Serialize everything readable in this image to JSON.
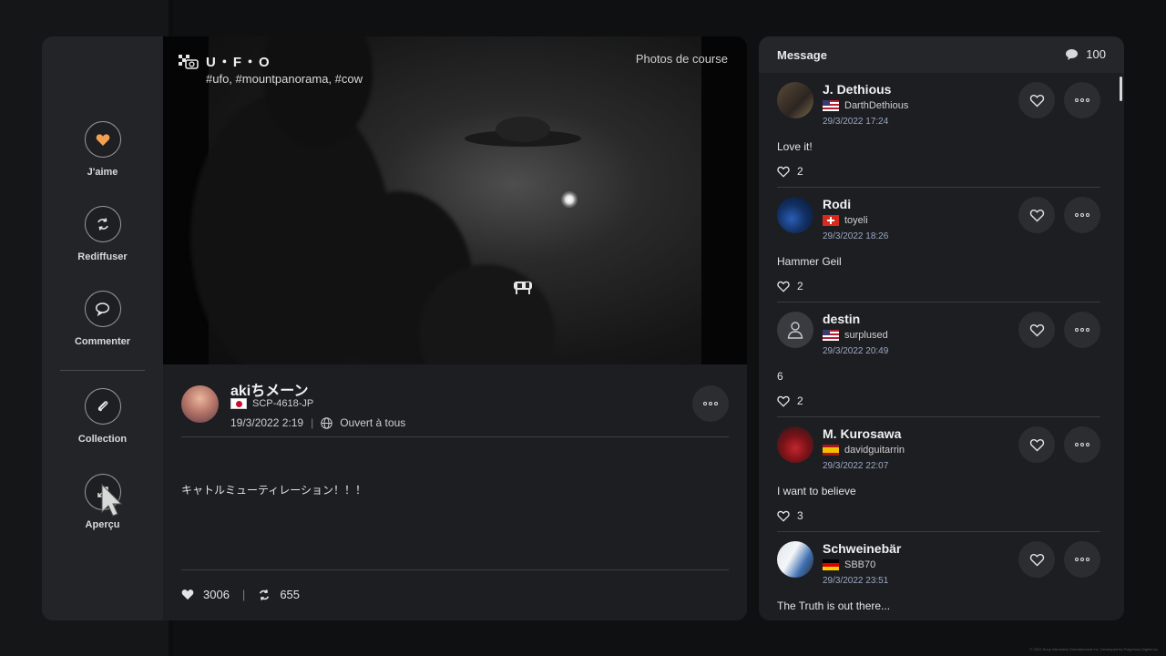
{
  "actions": {
    "like": "J'aime",
    "repost": "Rediffuser",
    "comment": "Commenter",
    "collection": "Collection",
    "preview": "Aperçu"
  },
  "photo": {
    "title": "U・F・O",
    "tags": "#ufo, #mountpanorama, #cow",
    "category": "Photos de course"
  },
  "post": {
    "author": "akiちメーン",
    "user_id": "SCP-4618-JP",
    "country_flag": "jp-flag-icon",
    "date": "19/3/2022 2:19",
    "visibility": "Ouvert à tous",
    "text": "キャトルミューティレーション！！！",
    "likes": "3006",
    "reposts": "655"
  },
  "messages": {
    "title": "Message",
    "count": "100",
    "items": [
      {
        "name": "J. Dethious",
        "user": "DarthDethious",
        "flag": "us",
        "date": "29/3/2022 17:24",
        "text": "Love it!",
        "likes": "2"
      },
      {
        "name": "Rodi",
        "user": "toyeli",
        "flag": "ch",
        "date": "29/3/2022 18:26",
        "text": "Hammer Geil",
        "likes": "2"
      },
      {
        "name": "destin",
        "user": "surplused",
        "flag": "us",
        "date": "29/3/2022 20:49",
        "text": "6",
        "likes": "2"
      },
      {
        "name": "M. Kurosawa",
        "user": "davidguitarrin",
        "flag": "es",
        "date": "29/3/2022 22:07",
        "text": "I want to believe",
        "likes": "3"
      },
      {
        "name": "Schweinebär",
        "user": "SBB70",
        "flag": "de",
        "date": "29/3/2022 23:51",
        "text": "The Truth is out there...",
        "likes": ""
      }
    ]
  },
  "footer": "© 2022 Sony Interactive Entertainment Inc. Developed by Polyphony Digital Inc.",
  "colors": {
    "accent_heart": "#f0a050",
    "panel": "#1d1e21",
    "date_text": "#9aa7c2"
  }
}
